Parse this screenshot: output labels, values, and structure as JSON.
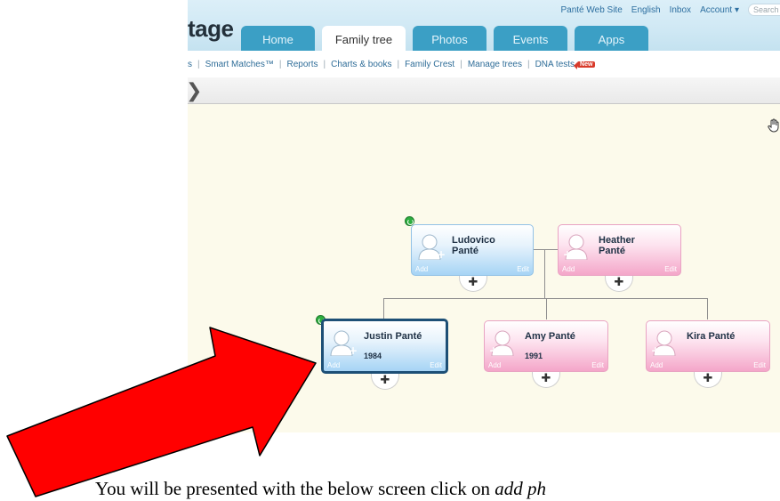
{
  "header": {
    "logo_text": "tage",
    "top_links": [
      "Panté Web Site",
      "English",
      "Inbox",
      "Account ▾"
    ],
    "search_placeholder": "Search"
  },
  "tabs": [
    {
      "label": "Home",
      "active": false
    },
    {
      "label": "Family tree",
      "active": true
    },
    {
      "label": "Photos",
      "active": false
    },
    {
      "label": "Events",
      "active": false
    },
    {
      "label": "Apps",
      "active": false
    }
  ],
  "subnav": {
    "items": [
      "s",
      "Smart Matches™",
      "Reports",
      "Charts & books",
      "Family Crest",
      "Manage trees",
      "DNA tests"
    ],
    "new_badge": "New"
  },
  "breadcrumb": {
    "chevron": "❯"
  },
  "tree": {
    "people": [
      {
        "first": "Ludovico",
        "last": "Panté",
        "year": "",
        "gender": "male"
      },
      {
        "first": "Heather",
        "last": "Panté",
        "year": "",
        "gender": "female"
      },
      {
        "name": "Justin Panté",
        "year": "1984",
        "gender": "male",
        "selected": true
      },
      {
        "name": "Amy Panté",
        "year": "1991",
        "gender": "female"
      },
      {
        "name": "Kira Panté",
        "year": "",
        "gender": "female"
      }
    ],
    "card_add_label": "Add",
    "card_edit_label": "Edit",
    "add_relative_glyph": "✚",
    "avatar_plus_glyph": "+"
  },
  "colors": {
    "tab_blue": "#3b9fc5",
    "male_card": "#a6d4f5",
    "female_card": "#f4a6c9",
    "selected_border": "#1d4f76",
    "arrow_red": "#ff0000"
  },
  "icons": {
    "pan": "hand-pan-icon",
    "sync": "sync-icon",
    "avatar": "person-silhouette-icon"
  },
  "caption": {
    "text": "You will be presented with the below screen click on ",
    "emphasis": "add ph"
  }
}
